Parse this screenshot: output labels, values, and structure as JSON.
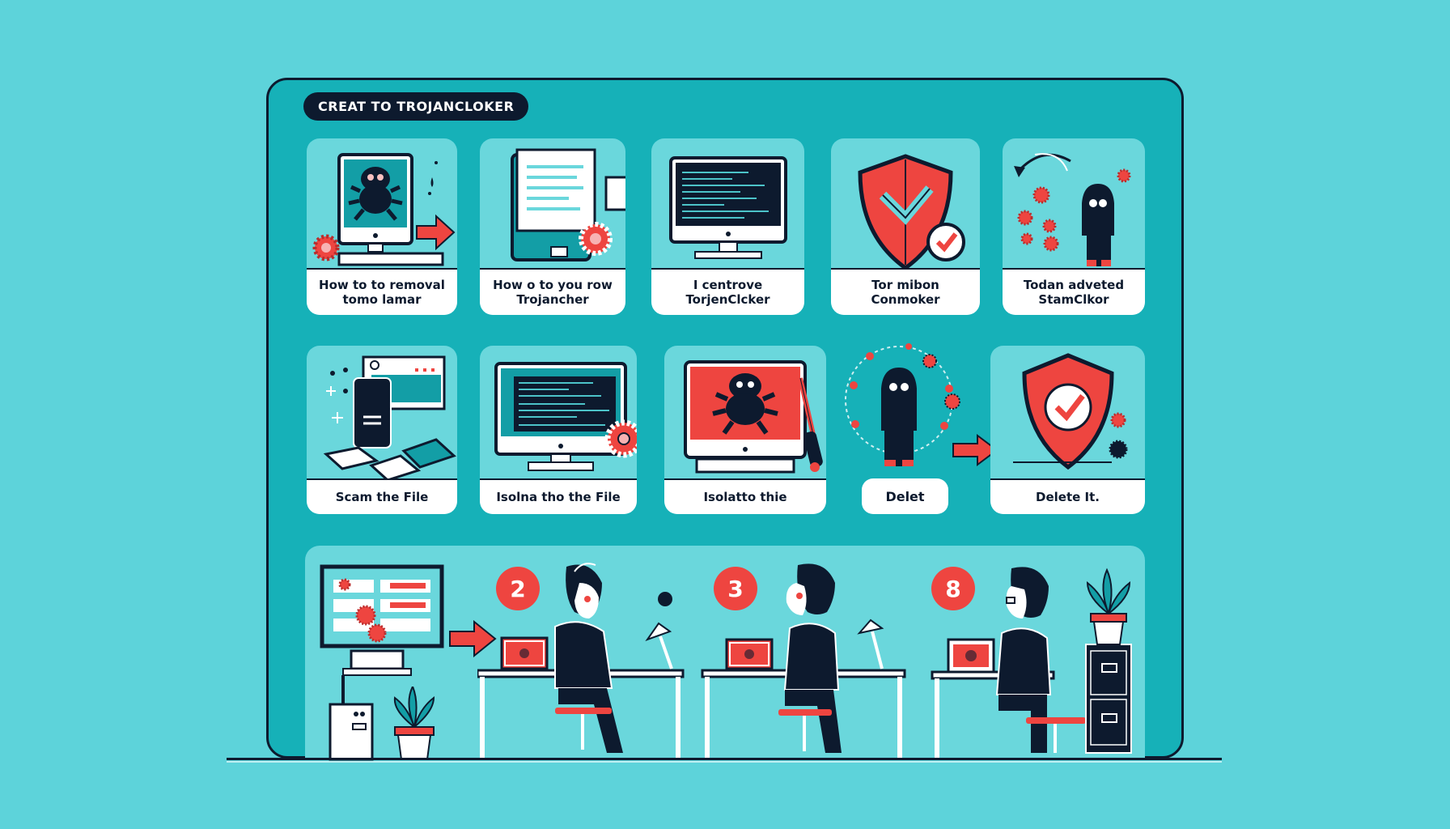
{
  "title": "CREAT TO TROJANCLOKER",
  "colors": {
    "background": "#5dd3da",
    "frame": "#16b1b8",
    "card": "#6ad7dc",
    "accent_red": "#ee4540",
    "ink": "#0d1a2e",
    "label_bg": "#ffffff"
  },
  "row1": [
    {
      "label": "How to to removal tomo lamar",
      "icon": "monitor-bug-icon"
    },
    {
      "label": "How o to you row Trojancher",
      "icon": "document-gear-icon"
    },
    {
      "label": "I centrove TorjenClcker",
      "icon": "terminal-monitor-icon"
    },
    {
      "label": "Tor mibon Conmoker",
      "icon": "shield-check-icon"
    },
    {
      "label": "Todan adveted StamClkor",
      "icon": "hooded-hacker-icon"
    }
  ],
  "row2": [
    {
      "label": "Scam the File",
      "icon": "phone-scan-icon"
    },
    {
      "label": "Isolna tho the File",
      "icon": "terminal-gear-icon"
    },
    {
      "label": "Isolatto thie",
      "icon": "monitor-bug-screwdriver-icon"
    },
    {
      "label": "Delet",
      "icon": "hacker-virus-ring-icon"
    },
    {
      "label": "Delete It.",
      "icon": "shield-check-icon"
    }
  ],
  "steps": [
    {
      "number": "2"
    },
    {
      "number": "3"
    },
    {
      "number": "8"
    }
  ]
}
